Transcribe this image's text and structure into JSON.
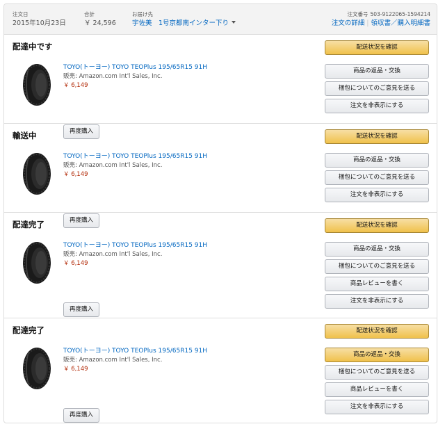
{
  "header": {
    "order_date_label": "注文日",
    "order_date": "2015年10月23日",
    "total_label": "合計",
    "total": "￥ 24,596",
    "ship_to_label": "お届け先",
    "ship_to_name": "宇佐美　1号京都南インター下り",
    "order_number_label": "注文番号",
    "order_number": "503-9122065-1594214",
    "order_details_link": "注文の詳細",
    "invoice_link": "領収書／購入明細書",
    "link_separator": "|"
  },
  "shipments": [
    {
      "status": "配達中です",
      "product_title": "TOYO(トーヨー) TOYO TEOPlus 195/65R15 91H",
      "seller": "販売: Amazon.com Int'l Sales, Inc.",
      "price": "￥ 6,149",
      "rebuy_label": "再度購入",
      "actions": [
        {
          "label": "配送状況を確認",
          "primary": true
        },
        {
          "label": "商品の返品・交換",
          "primary": false
        },
        {
          "label": "梱包についてのご意見を送る",
          "primary": false
        },
        {
          "label": "注文を非表示にする",
          "primary": false
        }
      ]
    },
    {
      "status": "輸送中",
      "product_title": "TOYO(トーヨー) TOYO TEOPlus 195/65R15 91H",
      "seller": "販売: Amazon.com Int'l Sales, Inc.",
      "price": "￥ 6,149",
      "rebuy_label": "再度購入",
      "actions": [
        {
          "label": "配送状況を確認",
          "primary": true
        },
        {
          "label": "商品の返品・交換",
          "primary": false
        },
        {
          "label": "梱包についてのご意見を送る",
          "primary": false
        },
        {
          "label": "注文を非表示にする",
          "primary": false
        }
      ]
    },
    {
      "status": "配達完了",
      "product_title": "TOYO(トーヨー) TOYO TEOPlus 195/65R15 91H",
      "seller": "販売: Amazon.com Int'l Sales, Inc.",
      "price": "￥ 6,149",
      "rebuy_label": "再度購入",
      "actions": [
        {
          "label": "配送状況を確認",
          "primary": true
        },
        {
          "label": "商品の返品・交換",
          "primary": false
        },
        {
          "label": "梱包についてのご意見を送る",
          "primary": false
        },
        {
          "label": "商品レビューを書く",
          "primary": false
        },
        {
          "label": "注文を非表示にする",
          "primary": false
        }
      ]
    },
    {
      "status": "配達完了",
      "product_title": "TOYO(トーヨー) TOYO TEOPlus 195/65R15 91H",
      "seller": "販売: Amazon.com Int'l Sales, Inc.",
      "price": "￥ 6,149",
      "rebuy_label": "再度購入",
      "actions": [
        {
          "label": "配送状況を確認",
          "primary": true
        },
        {
          "label": "商品の返品・交換",
          "primary": true
        },
        {
          "label": "梱包についてのご意見を送る",
          "primary": false
        },
        {
          "label": "商品レビューを書く",
          "primary": false
        },
        {
          "label": "注文を非表示にする",
          "primary": false
        }
      ]
    }
  ]
}
